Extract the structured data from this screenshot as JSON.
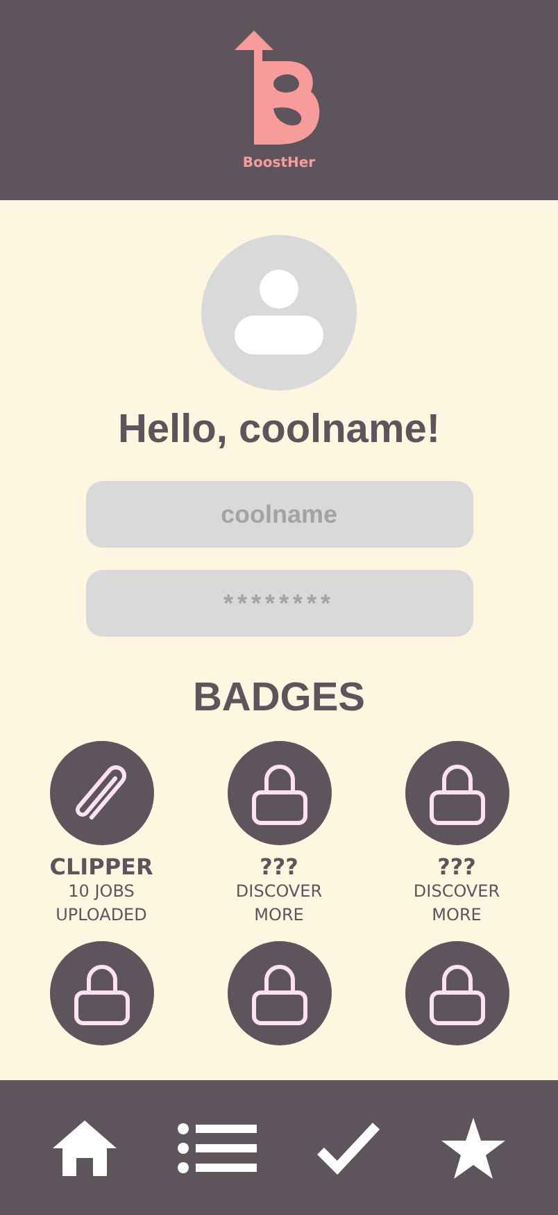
{
  "header": {
    "logo_text": "BoostHer"
  },
  "greeting": "Hello, coolname!",
  "fields": [
    {
      "kind": "text",
      "value": "coolname"
    },
    {
      "kind": "password",
      "value": "********"
    }
  ],
  "badges_title": "BADGES",
  "badges": [
    {
      "kind": "unlocked",
      "title": "CLIPPER",
      "description": "10 JOBS UPLOADED"
    },
    {
      "kind": "locked",
      "title": "???",
      "description": "DISCOVER MORE"
    },
    {
      "kind": "locked",
      "title": "???",
      "description": "DISCOVER MORE"
    },
    {
      "kind": "locked"
    },
    {
      "kind": "locked"
    },
    {
      "kind": "locked"
    }
  ],
  "nav": [
    {
      "kind": "home"
    },
    {
      "kind": "list"
    },
    {
      "kind": "check"
    },
    {
      "kind": "star"
    }
  ]
}
